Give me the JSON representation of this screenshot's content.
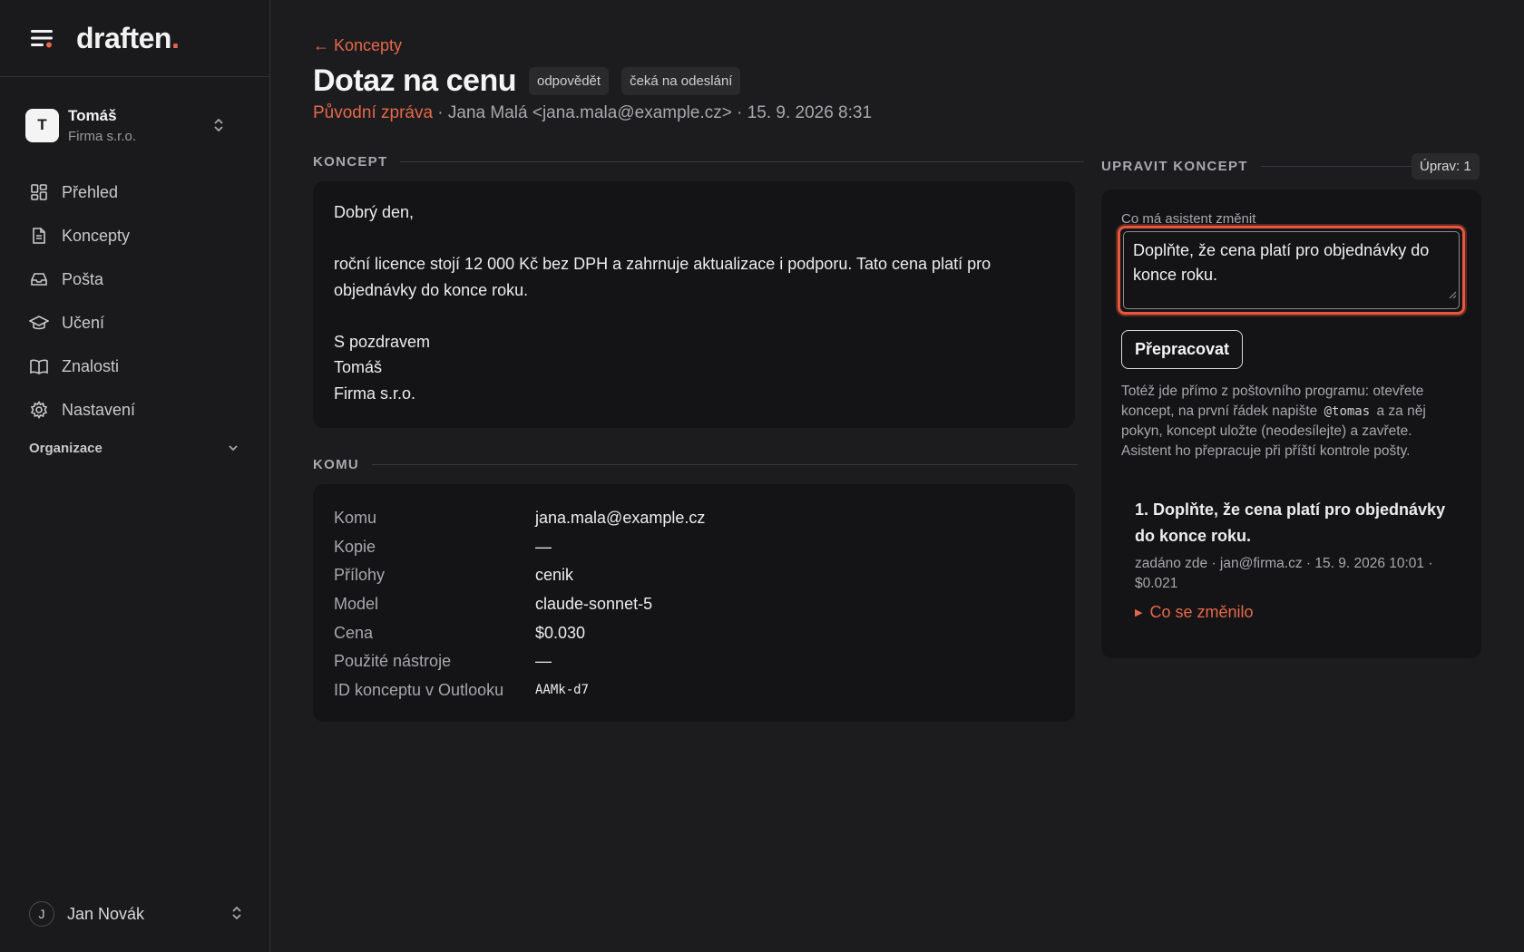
{
  "app": {
    "logo_text": "draften",
    "logo_dot": "."
  },
  "account": {
    "initial": "T",
    "name": "Tomáš",
    "company": "Firma s.r.o."
  },
  "nav": [
    {
      "label": "Přehled",
      "icon": "grid-icon"
    },
    {
      "label": "Koncepty",
      "icon": "document-icon"
    },
    {
      "label": "Pošta",
      "icon": "inbox-icon"
    },
    {
      "label": "Učení",
      "icon": "graduation-cap-icon"
    },
    {
      "label": "Znalosti",
      "icon": "book-icon"
    },
    {
      "label": "Nastavení",
      "icon": "gear-icon"
    }
  ],
  "org_section": "Organizace",
  "user": {
    "initial": "J",
    "name": "Jan Novák"
  },
  "header": {
    "back_label": "← Koncepty",
    "title": "Dotaz na cenu",
    "badges": [
      "odpovědět",
      "čeká na odeslání"
    ],
    "original_link": "Původní zpráva",
    "meta_rest": " · Jana Malá <jana.mala@example.cz> · 15. 9. 2026 8:31"
  },
  "draft": {
    "section_label": "KONCEPT",
    "greeting": "Dobrý den,",
    "body": "roční licence stojí 12 000 Kč bez DPH a zahrnuje aktualizace i podporu. Tato cena platí pro objednávky do konce roku.",
    "closing": "S pozdravem",
    "sign_name": "Tomáš",
    "sign_company": "Firma s.r.o."
  },
  "details": {
    "section_label": "KOMU",
    "rows": [
      {
        "key": "Komu",
        "value": "jana.mala@example.cz"
      },
      {
        "key": "Kopie",
        "value": "—"
      },
      {
        "key": "Přílohy",
        "value": "cenik"
      },
      {
        "key": "Model",
        "value": "claude-sonnet-5"
      },
      {
        "key": "Cena",
        "value": "$0.030"
      },
      {
        "key": "Použité nástroje",
        "value": "—"
      },
      {
        "key": "ID konceptu v Outlooku",
        "value": "AAMk-d7"
      }
    ]
  },
  "edit": {
    "section_label": "UPRAVIT KONCEPT",
    "edits_badge": "Úprav: 1",
    "field_label": "Co má asistent změnit",
    "field_value": "Doplňte, že cena platí pro objednávky do konce roku.",
    "button_label": "Přepracovat",
    "help_before": "Totéž jde přímo z poštovního programu: otevřete koncept, na první řádek napište",
    "help_code": "@tomas",
    "help_after": "a za něj pokyn, koncept uložte (neodesílejte) a zavřete. Asistent ho přepracuje při příští kontrole pošty.",
    "history": [
      {
        "text": "1. Doplňte, že cena platí pro objednávky do konce roku.",
        "meta": "zadáno zde · jan@firma.cz · 15. 9. 2026 10:01 · $0.021",
        "changed_label": "Co se změnilo"
      }
    ]
  },
  "colors": {
    "accent": "#e6674a",
    "focus_ring": "#e9553d",
    "background": "#1c1c1e",
    "card": "#141416"
  }
}
